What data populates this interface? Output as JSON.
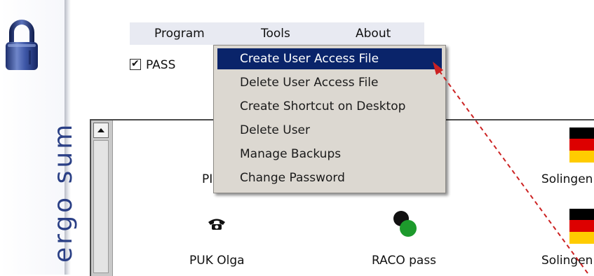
{
  "brand": {
    "vertical_text": "ergo sum"
  },
  "menubar": {
    "items": [
      {
        "label": "Program"
      },
      {
        "label": "Tools"
      },
      {
        "label": "About"
      }
    ]
  },
  "pass_checkbox": {
    "label": "PASS",
    "checked": true,
    "mark": "✔"
  },
  "dropdown": {
    "selected_index": 0,
    "items": [
      {
        "label": "Create User Access File"
      },
      {
        "label": "Delete User Access File"
      },
      {
        "label": "Create Shortcut on Desktop"
      },
      {
        "label": "Delete User"
      },
      {
        "label": "Manage Backups"
      },
      {
        "label": "Change Password"
      }
    ]
  },
  "list": {
    "items": [
      {
        "label": "PI",
        "icon": "none"
      },
      {
        "label": "Solingen",
        "icon": "german-flag-icon"
      },
      {
        "label": "PUK Olga",
        "icon": "telephone-icon"
      },
      {
        "label": "RACO pass",
        "icon": "circles-icon"
      },
      {
        "label": "Solingen",
        "icon": "german-flag-icon"
      }
    ]
  },
  "colors": {
    "selection": "#0a246a",
    "brand_text": "#2a3f85",
    "arrow": "#cc2222",
    "menu_bg": "#dcd8d1"
  }
}
